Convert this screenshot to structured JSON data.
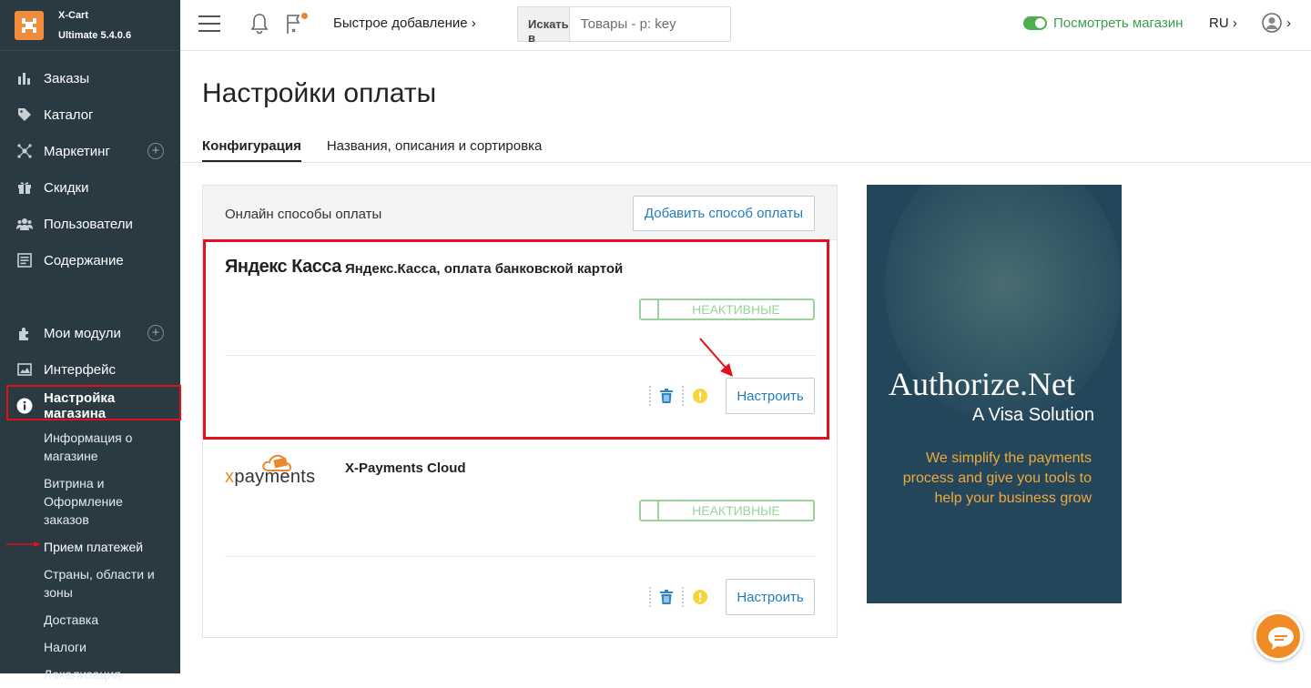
{
  "brand": {
    "name": "X-Cart",
    "version": "Ultimate 5.4.0.6"
  },
  "sidebar": {
    "items": [
      {
        "label": "Заказы",
        "icon": "chart-icon"
      },
      {
        "label": "Каталог",
        "icon": "tag-icon"
      },
      {
        "label": "Маркетинг",
        "icon": "network-icon"
      },
      {
        "label": "Скидки",
        "icon": "gift-icon"
      },
      {
        "label": "Пользователи",
        "icon": "users-icon"
      },
      {
        "label": "Содержание",
        "icon": "content-icon"
      },
      {
        "label": "Мои модули",
        "icon": "puzzle-icon"
      },
      {
        "label": "Интерфейс",
        "icon": "image-icon"
      },
      {
        "label": "Настройка магазина",
        "icon": "info-icon"
      }
    ],
    "sub_items": [
      "Информация о магазине",
      "Витрина и Оформление заказов",
      "Прием платежей",
      "Страны, области и зоны",
      "Доставка",
      "Налоги",
      "Локализация"
    ]
  },
  "topbar": {
    "quick_add": "Быстрое добавление",
    "search_in": "Искать в",
    "search_placeholder": "Товары - p: key",
    "view_store": "Посмотреть магазин",
    "lang": "RU"
  },
  "page": {
    "title": "Настройки оплаты",
    "tabs": [
      "Конфигурация",
      "Названия, описания и сортировка"
    ]
  },
  "panel": {
    "heading": "Онлайн способы оплаты",
    "add_button": "Добавить способ оплаты",
    "methods": [
      {
        "logo": "Яндекс Касса",
        "name": "Яндекс.Касса, оплата банковской картой",
        "status": "НЕАКТИВНЫЕ",
        "configure": "Настроить"
      },
      {
        "logo": "xpayments",
        "name": "X-Payments Cloud",
        "status": "НЕАКТИВНЫЕ",
        "configure": "Настроить"
      }
    ]
  },
  "ad": {
    "title": "Authorize.Net",
    "subtitle": "A Visa Solution",
    "tagline_1": "We simplify the payments",
    "tagline_2": "process and give you tools to",
    "tagline_3": "help your business grow"
  },
  "colors": {
    "sidebar": "#2a3a43",
    "accent": "#1f7dc0",
    "brand": "#f08d3d",
    "highlight": "#e3101b",
    "status": "#9ad39b"
  }
}
